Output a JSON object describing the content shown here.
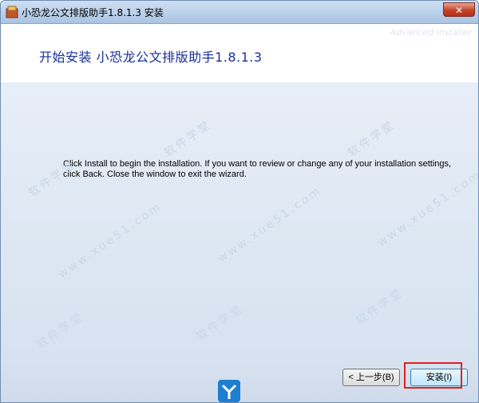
{
  "window": {
    "title": "小恐龙公文排版助手1.8.1.3 安装",
    "close_glyph": "✕"
  },
  "header": {
    "brand": "Advanced Installer",
    "heading": "开始安装 小恐龙公文排版助手1.8.1.3"
  },
  "content": {
    "message": "Click Install to begin the installation.  If you want to review or change any of your installation settings, click Back.  Close the window to exit the wizard."
  },
  "buttons": {
    "back_label": "< 上一步(B)",
    "install_label": "安装(I)"
  },
  "watermark": {
    "text1": "软件学堂",
    "text2": "www.xue51.com"
  },
  "icons": {
    "app": "installer-box-icon",
    "close": "close-icon",
    "logo": "xue51-logo-icon"
  },
  "colors": {
    "heading": "#1a2f9c",
    "highlight": "#e02020",
    "close": "#c4432a"
  }
}
